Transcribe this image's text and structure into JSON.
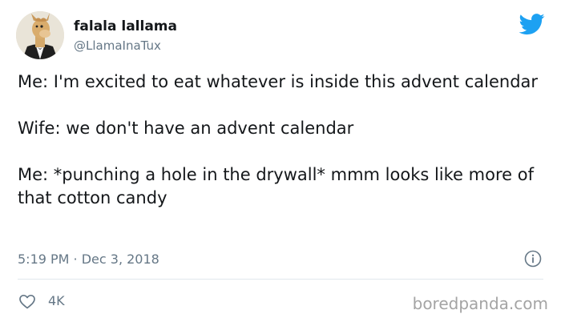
{
  "user": {
    "display_name": "falala lallama",
    "handle": "@LlamaInaTux",
    "avatar_icon": "llama-in-tuxedo-avatar"
  },
  "brand": {
    "icon": "twitter-bird-icon",
    "color": "#1da1f2"
  },
  "tweet": {
    "paragraphs": [
      "Me: I'm excited to eat whatever is inside this advent calendar",
      "Wife: we don't have an advent calendar",
      "Me: *punching a hole in the drywall* mmm looks like more of that cotton candy"
    ],
    "timestamp": "5:19 PM · Dec 3, 2018"
  },
  "actions": {
    "like_icon": "heart-icon",
    "like_count": "4K",
    "info_icon": "info-icon"
  },
  "watermark": "boredpanda.com",
  "colors": {
    "text": "#14171a",
    "muted": "#657786",
    "divider": "#e1e8ed",
    "watermark": "#a4a4a4"
  }
}
